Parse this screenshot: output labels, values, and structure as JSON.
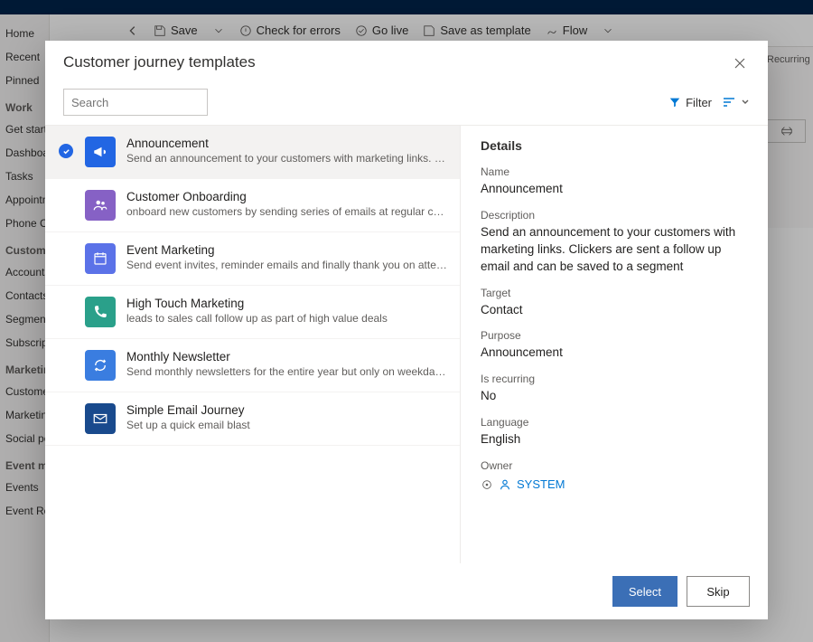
{
  "commandBar": {
    "save": "Save",
    "check": "Check for errors",
    "golive": "Go live",
    "saveTemplate": "Save as template",
    "flow": "Flow"
  },
  "sidebar": {
    "home": "Home",
    "recent": "Recent",
    "pinned": "Pinned",
    "work_h": "Work",
    "getstart": "Get started",
    "dashboards": "Dashboards",
    "tasks": "Tasks",
    "appoint": "Appointments",
    "phone": "Phone Calls",
    "customers_h": "Customers",
    "accounts": "Accounts",
    "contacts": "Contacts",
    "segments": "Segments",
    "subscr": "Subscription lists",
    "mkt_h": "Marketing execution",
    "cj": "Customer journeys",
    "me": "Marketing emails",
    "sp": "Social posts",
    "mgt_h": "Event management",
    "events": "Events",
    "reg": "Event Registrations"
  },
  "rightRail": {
    "recurring": "Recurring"
  },
  "modal": {
    "title": "Customer journey templates",
    "searchPlaceholder": "Search",
    "filter": "Filter",
    "select": "Select",
    "skip": "Skip"
  },
  "templates": [
    {
      "title": "Announcement",
      "desc": "Send an announcement to your customers with marketing links. Clickers are sent a…",
      "color": "#2266e3",
      "icon": "megaphone",
      "selected": true
    },
    {
      "title": "Customer Onboarding",
      "desc": "onboard new customers by sending series of emails at regular cadence",
      "color": "#8661c5",
      "icon": "people",
      "selected": false
    },
    {
      "title": "Event Marketing",
      "desc": "Send event invites, reminder emails and finally thank you on attending",
      "color": "#5b72e8",
      "icon": "calendar",
      "selected": false
    },
    {
      "title": "High Touch Marketing",
      "desc": "leads to sales call follow up as part of high value deals",
      "color": "#2aa08a",
      "icon": "phone",
      "selected": false
    },
    {
      "title": "Monthly Newsletter",
      "desc": "Send monthly newsletters for the entire year but only on weekday afternoons",
      "color": "#3a7de0",
      "icon": "cycle",
      "selected": false
    },
    {
      "title": "Simple Email Journey",
      "desc": "Set up a quick email blast",
      "color": "#194a8d",
      "icon": "mail",
      "selected": false
    }
  ],
  "details": {
    "heading": "Details",
    "name_l": "Name",
    "name": "Announcement",
    "desc_l": "Description",
    "desc": "Send an announcement to your customers with marketing links. Clickers are sent a follow up email and can be saved to a segment",
    "target_l": "Target",
    "target": "Contact",
    "purpose_l": "Purpose",
    "purpose": "Announcement",
    "recurring_l": "Is recurring",
    "recurring": "No",
    "lang_l": "Language",
    "lang": "English",
    "owner_l": "Owner",
    "owner": "SYSTEM"
  }
}
